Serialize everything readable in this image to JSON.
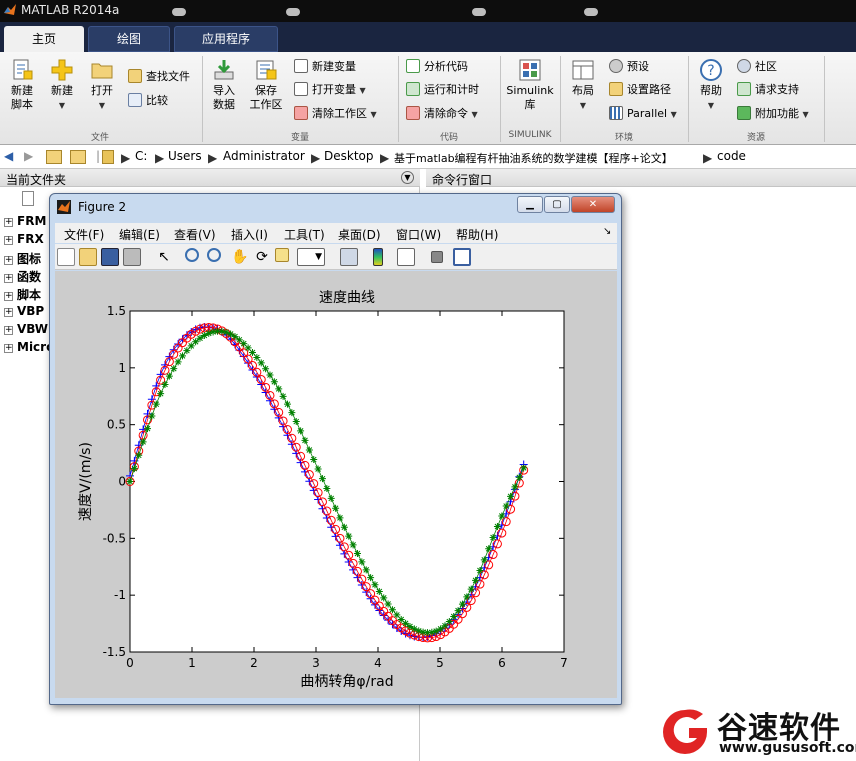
{
  "app": {
    "title": "MATLAB R2014a"
  },
  "tabs": [
    {
      "label": "主页"
    },
    {
      "label": "绘图"
    },
    {
      "label": "应用程序"
    }
  ],
  "ribbon": {
    "file": {
      "group_label": "文件",
      "new_script": "新建\n脚本",
      "new": "新建",
      "open": "打开",
      "find_files": "查找文件",
      "compare": "比较"
    },
    "variable": {
      "group_label": "变量",
      "import": "导入\n数据",
      "save_workspace": "保存\n工作区",
      "new_variable": "新建变量",
      "open_variable": "打开变量",
      "clear_workspace": "清除工作区"
    },
    "code": {
      "group_label": "代码",
      "analyze": "分析代码",
      "run_time": "运行和计时",
      "clear_commands": "清除命令"
    },
    "simulink": {
      "group_label": "SIMULINK",
      "library": "Simulink\n库"
    },
    "environment": {
      "group_label": "环境",
      "layout": "布局",
      "preferences": "预设",
      "set_path": "设置路径",
      "parallel": "Parallel"
    },
    "resources": {
      "group_label": "资源",
      "help": "帮助",
      "community": "社区",
      "request_support": "请求支持",
      "addons": "附加功能"
    }
  },
  "address": {
    "crumbs": [
      "C:",
      "Users",
      "Administrator",
      "Desktop",
      "基于matlab编程有杆抽油系统的数学建模【程序+论文】",
      "code"
    ]
  },
  "current_folder": {
    "title": "当前文件夹",
    "items": [
      "FRM",
      "FRX",
      "图标",
      "函数",
      "脚本",
      "VBP",
      "VBW",
      "Micro"
    ]
  },
  "command_window": {
    "title": "命令行窗口"
  },
  "figure": {
    "title": "Figure 2",
    "menu": [
      "文件(F)",
      "编辑(E)",
      "查看(V)",
      "插入(I)",
      "工具(T)",
      "桌面(D)",
      "窗口(W)",
      "帮助(H)"
    ]
  },
  "chart_data": {
    "type": "line",
    "title": "速度曲线",
    "xlabel": "曲柄转角φ/rad",
    "ylabel": "速度V/(m/s)",
    "xlim": [
      0,
      7
    ],
    "ylim": [
      -1.5,
      1.5
    ],
    "xticks": [
      0,
      1,
      2,
      3,
      4,
      5,
      6,
      7
    ],
    "yticks": [
      -1.5,
      -1,
      -0.5,
      0,
      0.5,
      1,
      1.5
    ],
    "x": [
      0,
      0.5,
      1,
      1.5,
      2,
      2.5,
      3,
      3.5,
      4,
      4.5,
      5,
      5.5,
      6,
      6.35
    ],
    "series": [
      {
        "marker": "+",
        "color": "#0000ff",
        "values": [
          0.05,
          0.95,
          1.32,
          1.31,
          0.96,
          0.45,
          -0.12,
          -0.68,
          -1.12,
          -1.35,
          -1.32,
          -1.0,
          -0.38,
          0.15
        ]
      },
      {
        "marker": "o",
        "color": "#ff0000",
        "values": [
          0.0,
          0.9,
          1.3,
          1.32,
          1.0,
          0.5,
          -0.06,
          -0.62,
          -1.08,
          -1.33,
          -1.35,
          -1.05,
          -0.45,
          0.1
        ]
      },
      {
        "marker": "*",
        "color": "#008000",
        "values": [
          0.0,
          0.78,
          1.2,
          1.32,
          1.12,
          0.72,
          0.15,
          -0.45,
          -0.95,
          -1.27,
          -1.3,
          -0.95,
          -0.3,
          0.12
        ]
      }
    ]
  },
  "watermark": {
    "name": "谷速软件",
    "url": "www.gususoft.com"
  }
}
